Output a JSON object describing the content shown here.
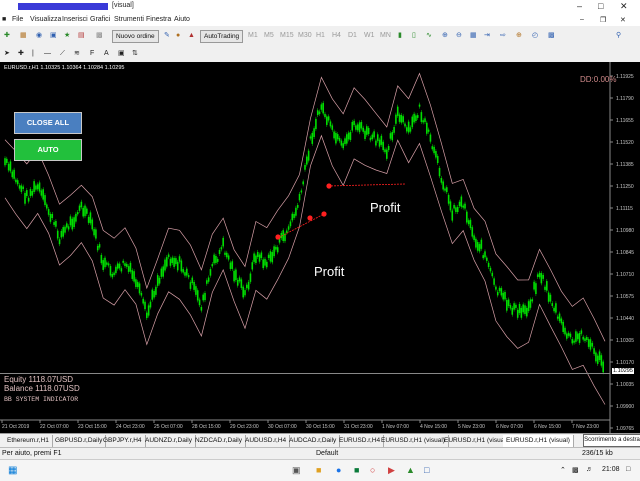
{
  "window": {
    "title": "[visual]"
  },
  "menu": [
    "File",
    "Visualizza",
    "Inserisci",
    "Grafici",
    "Strumenti",
    "Finestra",
    "Aiuto"
  ],
  "toolbar": {
    "new_order": "Nuovo ordine",
    "auto_trading": "AutoTrading",
    "timeframes": [
      "M1",
      "M5",
      "M15",
      "M30",
      "H1",
      "H4",
      "D1",
      "W1",
      "MN"
    ]
  },
  "chart": {
    "symbol_info": "EURUSD.r,H1  1.10325 1.10364 1.10284 1.10295",
    "dd_label": "DD:0.00%",
    "close_all": "CLOSE ALL",
    "auto": "AUTO",
    "profit_label_1": "Profit",
    "profit_label_2": "Profit",
    "equity": "Equity    1118.07USD",
    "balance": "Balance  1118.07USD",
    "indicator": "BB SYSTEM INDICATOR",
    "current_price": "1.10295",
    "colors": {
      "candle": "#00e000",
      "band": "#d8a0a8",
      "trade": "#ff2020",
      "close_all": "#4a7fc0",
      "auto": "#22c03c",
      "axis": "#c8c8c8"
    }
  },
  "chart_data": {
    "type": "line",
    "title": "",
    "y_ticks": [
      "1.11925",
      "1.11790",
      "1.11655",
      "1.11520",
      "1.11385",
      "1.11250",
      "1.11115",
      "1.10980",
      "1.10845",
      "1.10710",
      "1.10575",
      "1.10440",
      "1.10305",
      "1.10170",
      "1.10035",
      "1.09900",
      "1.09765"
    ],
    "x_ticks": [
      "21 Oct 2019",
      "22 Oct 07:00",
      "23 Oct 15:00",
      "24 Oct 23:00",
      "25 Oct 07:00",
      "28 Oct 15:00",
      "29 Oct 23:00",
      "30 Oct 07:00",
      "30 Oct 15:00",
      "31 Oct 23:00",
      "1 Nov 07:00",
      "4 Nov 15:00",
      "5 Nov 23:00",
      "6 Nov 07:00",
      "6 Nov 15:00",
      "7 Nov 23:00"
    ],
    "series": [
      {
        "values": [
          1.1148,
          1.1138,
          1.1128,
          1.1134,
          1.112,
          1.1105,
          1.1113,
          1.1122,
          1.1112,
          1.109,
          1.1084,
          1.109,
          1.108,
          1.106,
          1.108,
          1.1094,
          1.109,
          1.108,
          1.1066,
          1.1088,
          1.11,
          1.1085,
          1.1072,
          1.1095,
          1.109,
          1.11,
          1.111,
          1.1125,
          1.116,
          1.118,
          1.1165,
          1.1155,
          1.117,
          1.1165,
          1.116,
          1.1155,
          1.1175,
          1.1165,
          1.1178,
          1.116,
          1.114,
          1.112,
          1.1125,
          1.1105,
          1.1095,
          1.1075,
          1.1068,
          1.1062,
          1.1065,
          1.1085,
          1.107,
          1.1055,
          1.1045,
          1.105,
          1.104,
          1.103
        ]
      }
    ]
  },
  "tabs": [
    "Ethereum.r,H1",
    "GBPUSD.r,Daily",
    "GBPJPY.r,H4",
    "AUDNZD.r,Daily",
    "NZDCAD.r,Daily",
    "AUDUSD.r,H4",
    "AUDCAD.r,Daily",
    "EURUSD.r,H4",
    "EURUSD.r,H1 (visual)",
    "EURUSD.r,H1 (visual)",
    "EURUSD.r,H1 (visual)"
  ],
  "tooltip": "Scorrimento a destra",
  "status": {
    "help": "Per aiuto, premi F1",
    "profile": "Default",
    "traffic": "236/15 kb"
  },
  "taskbar": {
    "time": "21:08"
  }
}
